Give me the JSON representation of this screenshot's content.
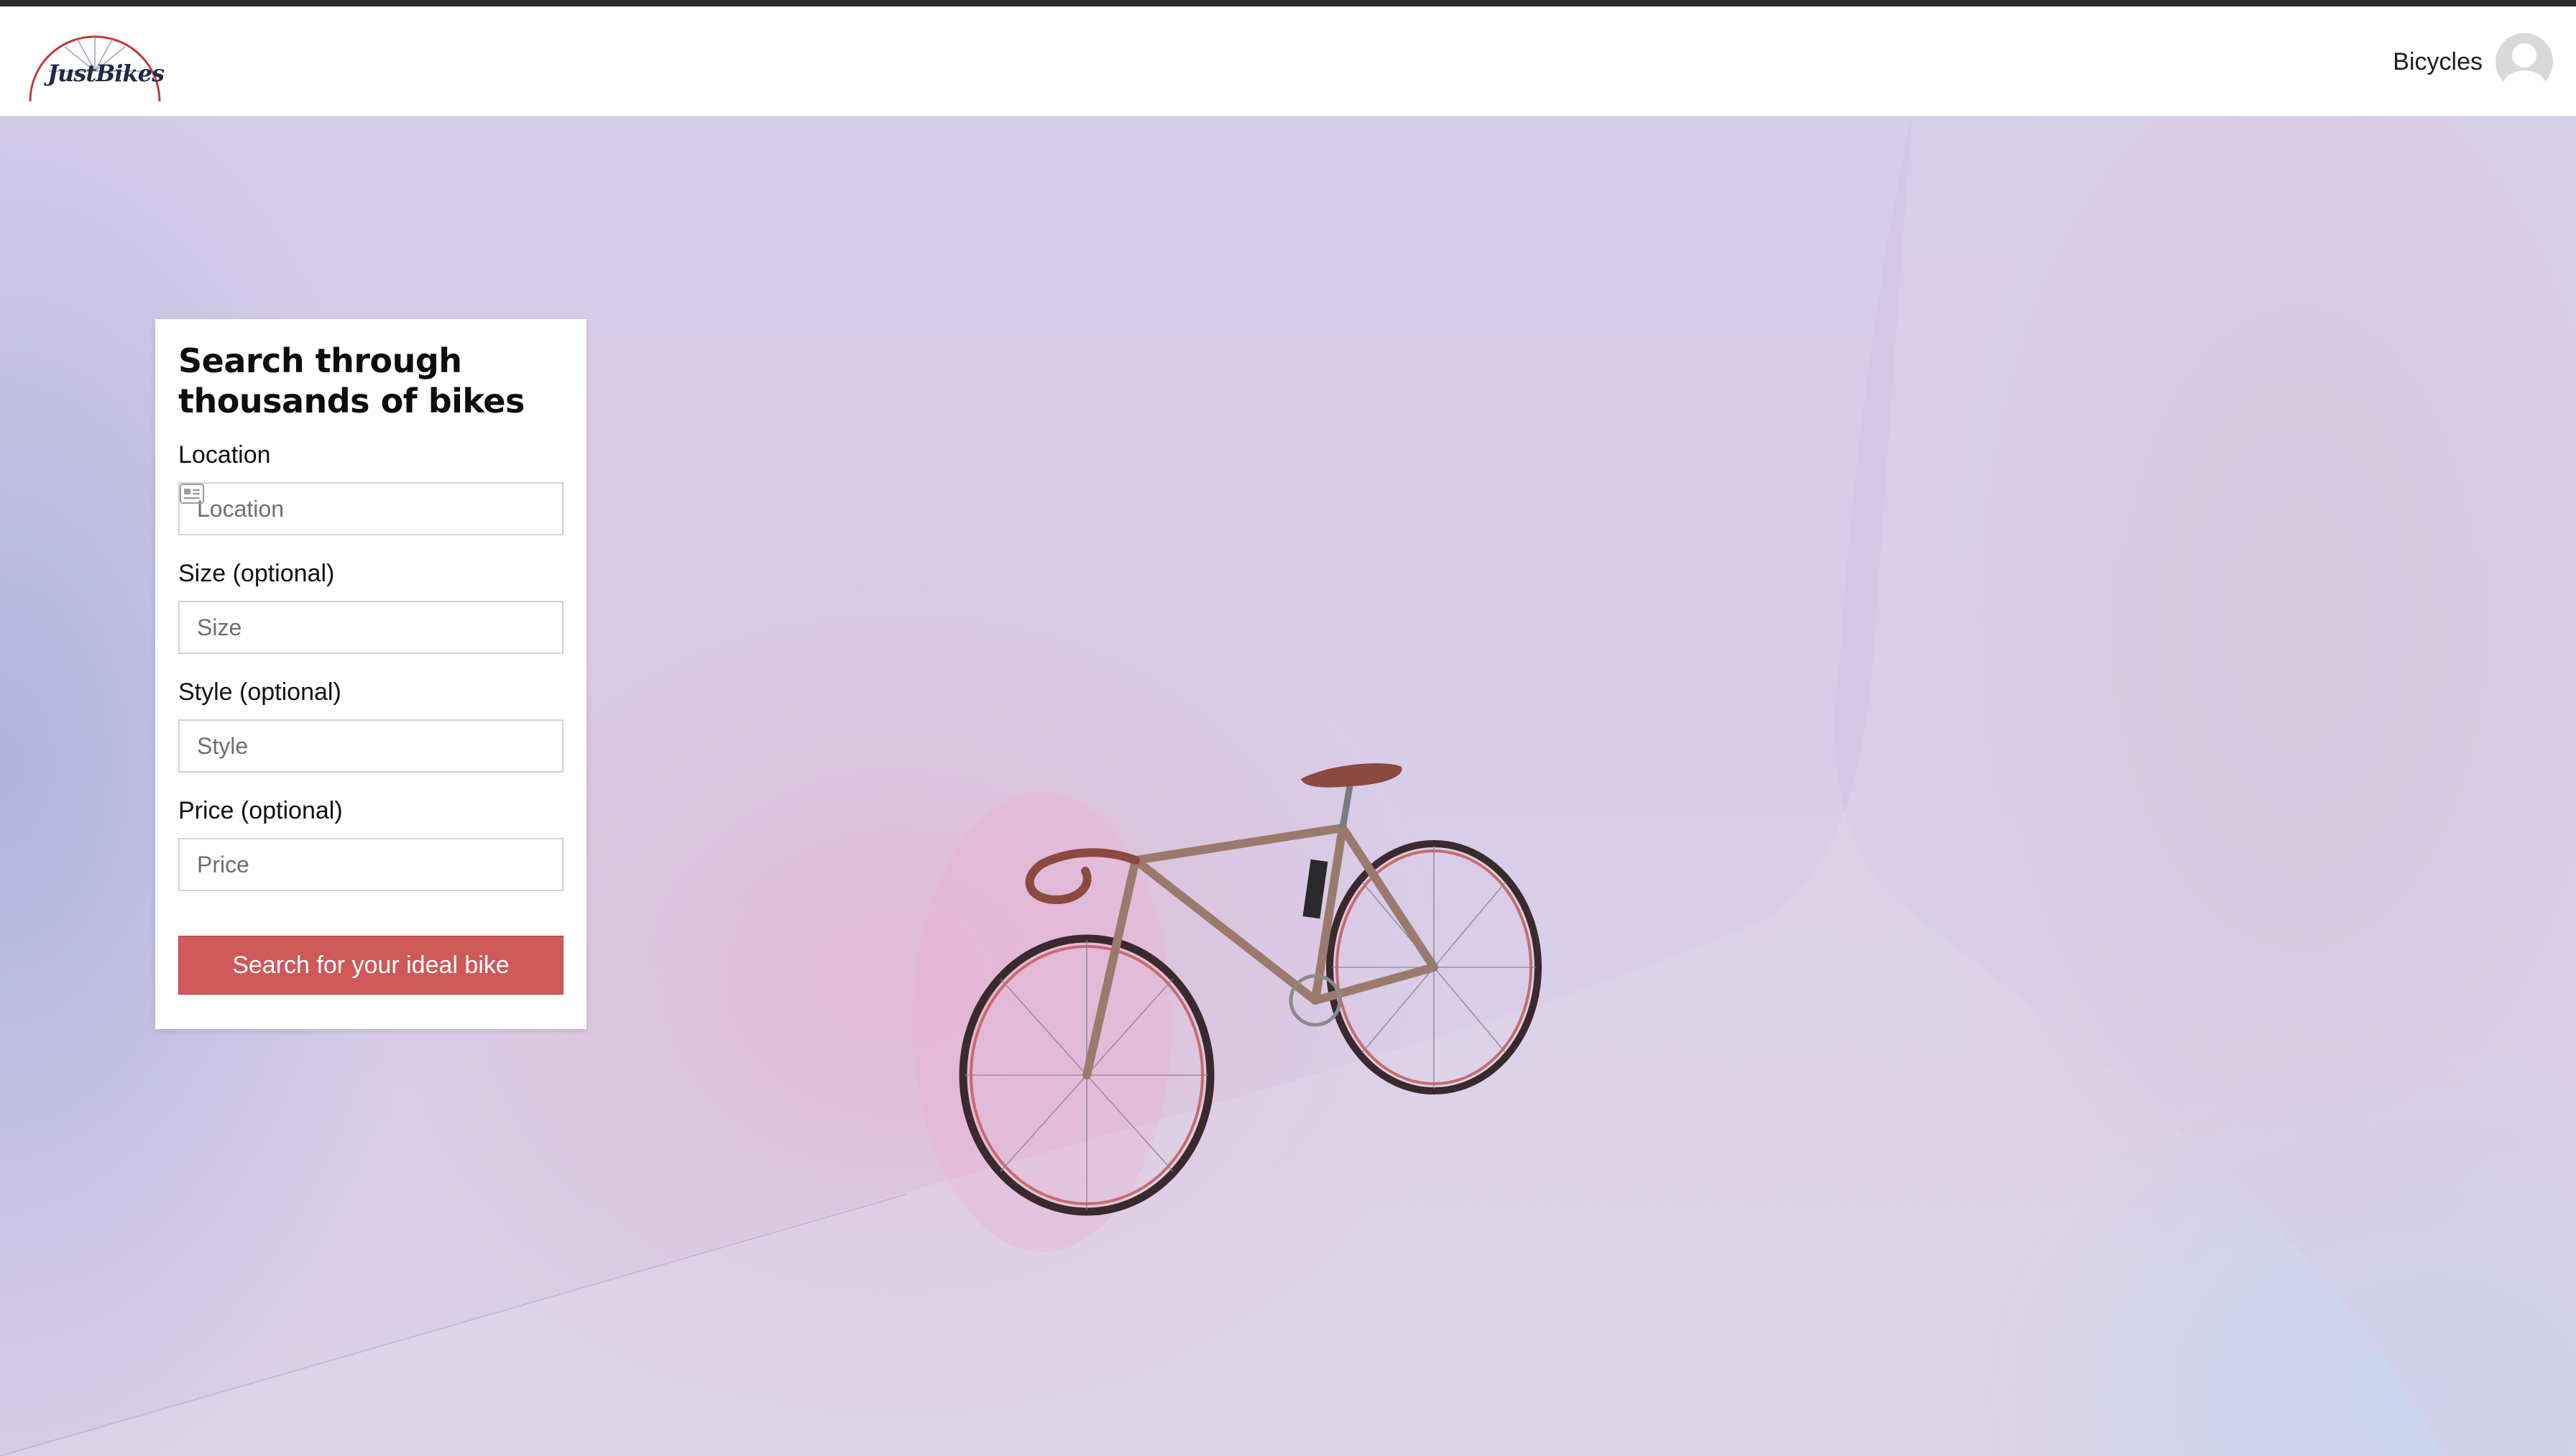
{
  "header": {
    "logo_text": "JustBikes",
    "nav_link": "Bicycles"
  },
  "search_card": {
    "title": "Search through thousands of bikes",
    "fields": [
      {
        "label": "Location",
        "placeholder": "Location"
      },
      {
        "label": "Size (optional)",
        "placeholder": "Size"
      },
      {
        "label": "Style (optional)",
        "placeholder": "Style"
      },
      {
        "label": "Price (optional)",
        "placeholder": "Price"
      }
    ],
    "submit_label": "Search for your ideal bike"
  },
  "colors": {
    "accent_button": "#cf5858",
    "logo_arc": "#c23a3a",
    "logo_text": "#1f2a44"
  },
  "icons": {
    "location_field": "contact-card-icon",
    "user": "avatar-icon"
  }
}
